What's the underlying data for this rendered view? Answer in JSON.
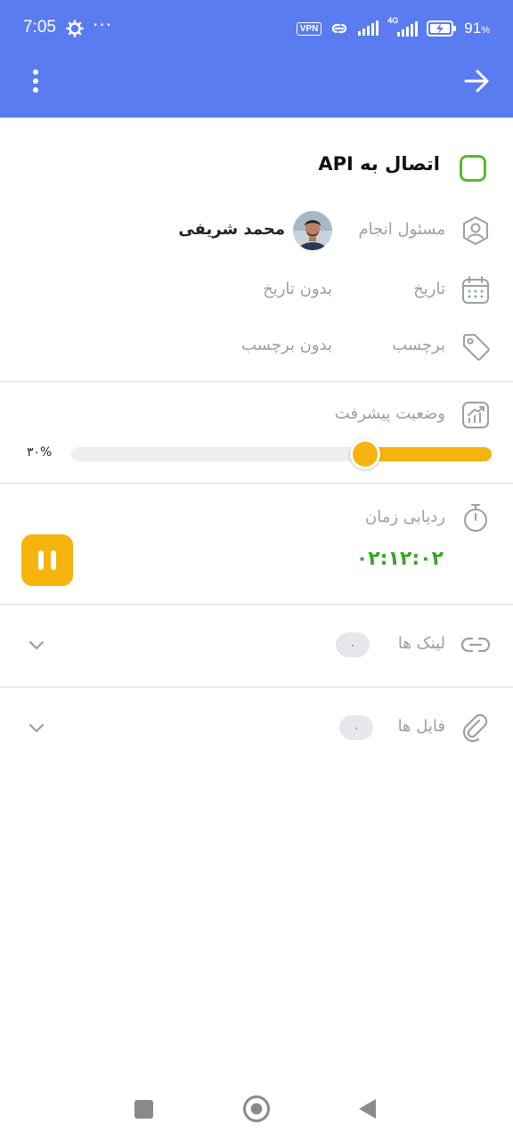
{
  "status_bar": {
    "time": "7:05",
    "more": "···",
    "vpn": "VPN",
    "network": "4G",
    "battery_percent": "91"
  },
  "task": {
    "title": "اتصال به API",
    "assignee_label": "مسئول انجام",
    "assignee_name": "محمد شریفی",
    "date_label": "تاریخ",
    "date_value": "بدون تاریخ",
    "tag_label": "برچسب",
    "tag_value": "بدون برچسب"
  },
  "progress": {
    "label": "وضعیت پیشرفت",
    "percent_text": "۳۰%",
    "value": 0.3
  },
  "time_tracking": {
    "label": "ردیابی زمان",
    "elapsed": "۰۲:۱۲:۰۲"
  },
  "links": {
    "label": "لینک ها",
    "count": "۰"
  },
  "files": {
    "label": "فایل ها",
    "count": "۰"
  },
  "colors": {
    "header": "#5b7cf0",
    "accent": "#f6b40e",
    "success": "#3aa52c",
    "checkbox": "#5cb82b"
  }
}
